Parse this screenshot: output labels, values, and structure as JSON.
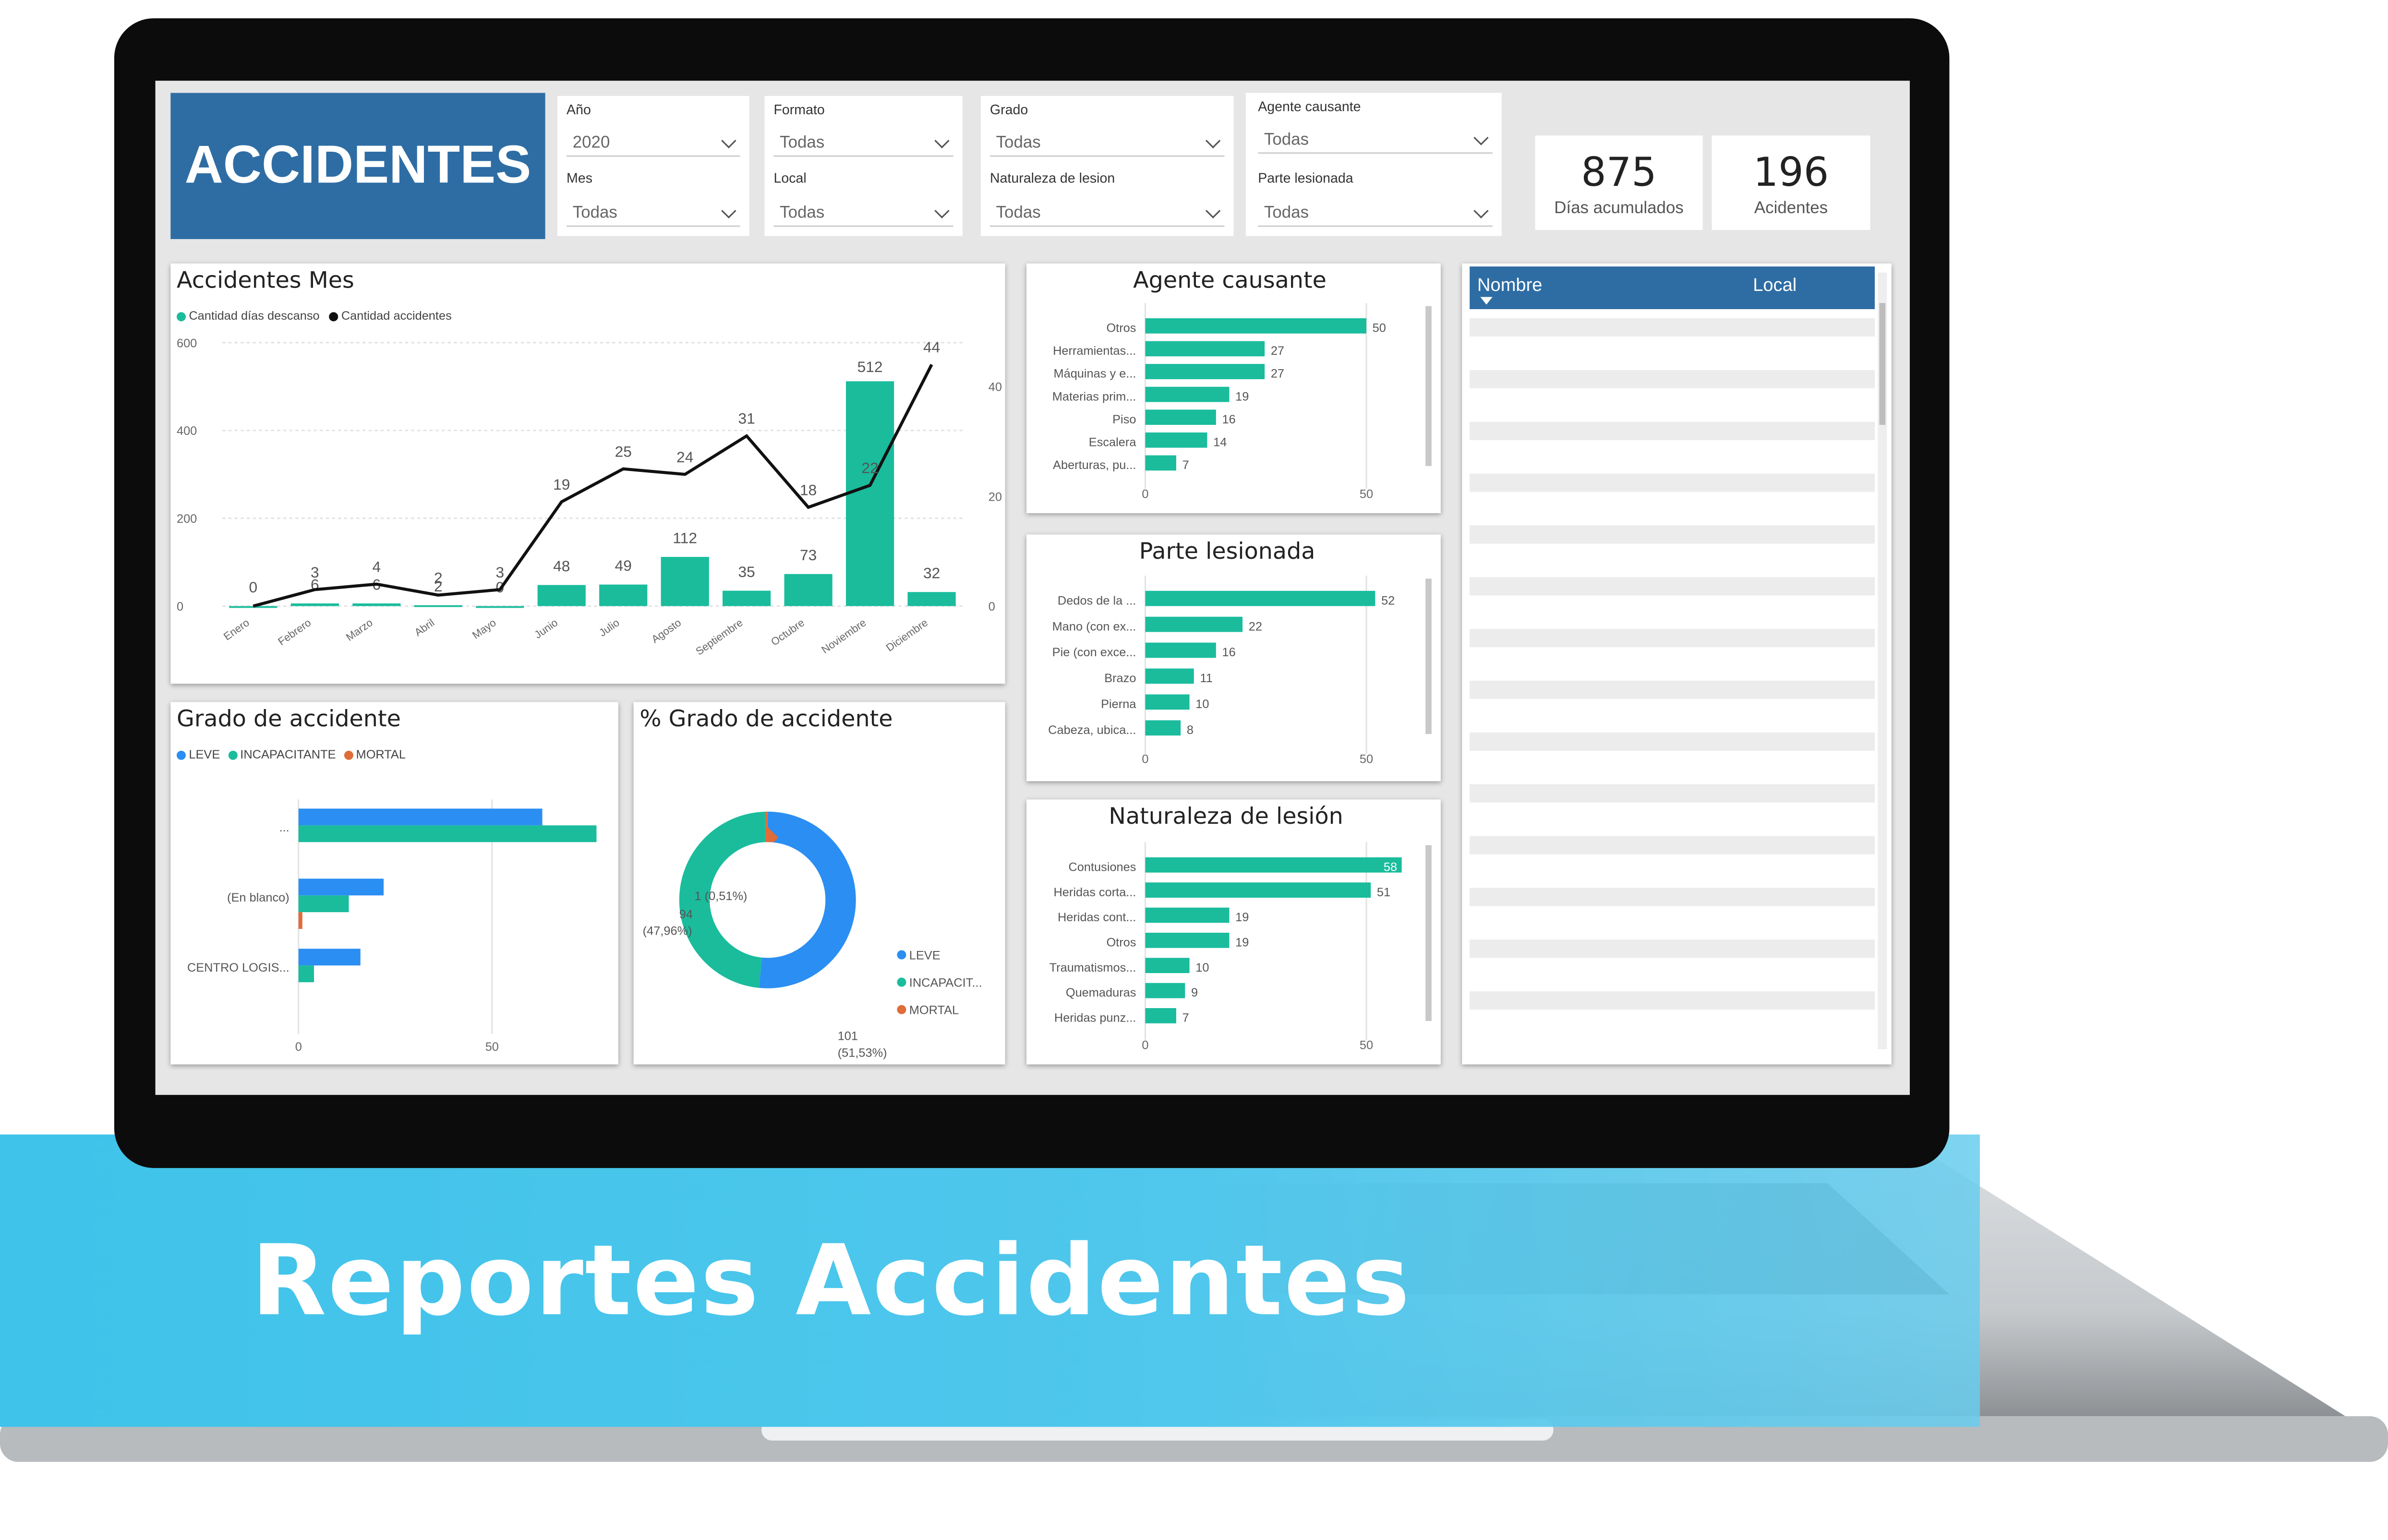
{
  "banner": {
    "title": "Reportes Accidentes"
  },
  "report": {
    "title": "ACCIDENTES"
  },
  "filters": {
    "year": {
      "label": "Año",
      "value": "2020"
    },
    "month": {
      "label": "Mes",
      "value": "Todas"
    },
    "format": {
      "label": "Formato",
      "value": "Todas"
    },
    "local": {
      "label": "Local",
      "value": "Todas"
    },
    "grade": {
      "label": "Grado",
      "value": "Todas"
    },
    "nature": {
      "label": "Naturaleza de lesion",
      "value": "Todas"
    },
    "agent": {
      "label": "Agente causante",
      "value": "Todas"
    },
    "part": {
      "label": "Parte lesionada",
      "value": "Todas"
    }
  },
  "kpis": [
    {
      "value": "875",
      "label": "Días acumulados"
    },
    {
      "value": "196",
      "label": "Acidentes"
    }
  ],
  "table": {
    "col1": "Nombre",
    "col2": "Local"
  },
  "colors": {
    "teal": "#1abc9c",
    "blue": "#2b8ef2",
    "orange": "#e06c3a",
    "title_bg": "#2e6da4",
    "banner": "#3fc3ea"
  },
  "chart_data": [
    {
      "type": "bar",
      "title": "Accidentes Mes",
      "legend": [
        "Cantidad días descanso",
        "Cantidad accidentes"
      ],
      "categories": [
        "Enero",
        "Febrero",
        "Marzo",
        "Abril",
        "Mayo",
        "Junio",
        "Julio",
        "Agosto",
        "Septiembre",
        "Octubre",
        "Noviembre",
        "Diciembre"
      ],
      "series": [
        {
          "name": "Cantidad días descanso",
          "kind": "bar",
          "values": [
            0,
            6,
            6,
            2,
            0,
            48,
            49,
            112,
            35,
            73,
            512,
            32
          ],
          "labels": [
            "0",
            "6",
            "6",
            "2",
            "0",
            "48",
            "49",
            "112",
            "35",
            "73",
            "512",
            "32"
          ]
        },
        {
          "name": "Cantidad accidentes",
          "kind": "line",
          "values": [
            0,
            3,
            4,
            2,
            3,
            19,
            25,
            24,
            31,
            18,
            22,
            44
          ],
          "labels": [
            "",
            "3",
            "4",
            "2",
            "3",
            "19",
            "25",
            "24",
            "31",
            "18",
            "22",
            "44"
          ]
        }
      ],
      "ylim_left": [
        0,
        600
      ],
      "yticks_left": [
        "0",
        "200",
        "400",
        "600"
      ],
      "ylim_right": [
        0,
        48
      ],
      "yticks_right": [
        "0",
        "20",
        "40"
      ]
    },
    {
      "type": "bar",
      "title": "Agente causante",
      "categories": [
        "Otros",
        "Herramientas...",
        "Máquinas y e...",
        "Materias prim...",
        "Piso",
        "Escalera",
        "Aberturas, pu..."
      ],
      "values": [
        50,
        27,
        27,
        19,
        16,
        14,
        7
      ],
      "xticks": [
        "0",
        "50"
      ],
      "xlim": [
        0,
        62
      ]
    },
    {
      "type": "bar",
      "title": "Parte lesionada",
      "categories": [
        "Dedos de la ...",
        "Mano (con ex...",
        "Pie (con exce...",
        "Brazo",
        "Pierna",
        "Cabeza, ubica..."
      ],
      "values": [
        52,
        22,
        16,
        11,
        10,
        8
      ],
      "xticks": [
        "0",
        "50"
      ],
      "xlim": [
        0,
        62
      ]
    },
    {
      "type": "bar",
      "title": "Naturaleza de lesión",
      "categories": [
        "Contusiones",
        "Heridas corta...",
        "Heridas cont...",
        "Otros",
        "Traumatismos...",
        "Quemaduras",
        "Heridas punz..."
      ],
      "values": [
        58,
        51,
        19,
        19,
        10,
        9,
        7
      ],
      "xticks": [
        "0",
        "50"
      ],
      "xlim": [
        0,
        62
      ]
    },
    {
      "type": "bar",
      "title": "Grado de accidente",
      "legend": [
        "LEVE",
        "INCAPACITANTE",
        "MORTAL"
      ],
      "categories": [
        "...",
        "(En blanco)",
        "CENTRO LOGIS..."
      ],
      "series": [
        {
          "name": "LEVE",
          "values": [
            63,
            22,
            16
          ]
        },
        {
          "name": "INCAPACITANTE",
          "values": [
            77,
            13,
            4
          ]
        },
        {
          "name": "MORTAL",
          "values": [
            0,
            1,
            0
          ]
        }
      ],
      "xticks": [
        "0",
        "50"
      ],
      "xlim": [
        0,
        85
      ]
    },
    {
      "type": "pie",
      "title": "% Grado de accidente",
      "legend": [
        "LEVE",
        "INCAPACIT...",
        "MORTAL"
      ],
      "values": [
        101,
        94,
        1
      ],
      "labels": [
        "101\n(51,53%)",
        "94\n(47,96%)",
        "1 (0,51%)"
      ]
    }
  ]
}
